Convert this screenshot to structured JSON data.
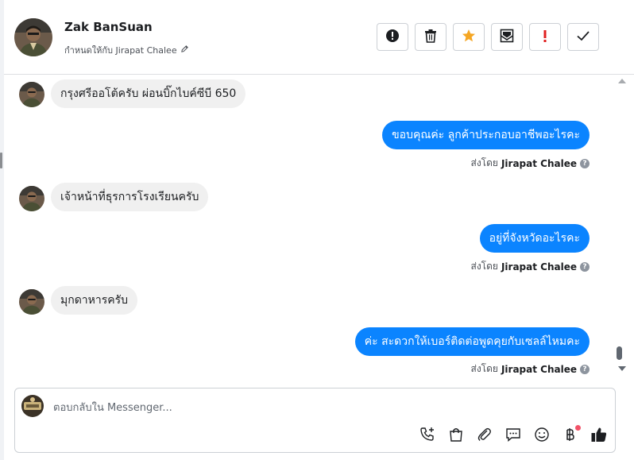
{
  "contact": {
    "name": "Zak BanSuan",
    "assign_label": "กำหนดให้กับ Jirapat Chalee"
  },
  "toolbar": {
    "buttons": [
      {
        "name": "spam-button",
        "icon": "exclamation-circle-icon"
      },
      {
        "name": "delete-button",
        "icon": "trash-icon"
      },
      {
        "name": "star-button",
        "icon": "star-icon",
        "color": "#f5a623"
      },
      {
        "name": "mark-unread-button",
        "icon": "envelope-icon"
      },
      {
        "name": "follow-up-button",
        "icon": "exclamation-icon",
        "color": "#e02020"
      },
      {
        "name": "mark-done-button",
        "icon": "checkmark-icon"
      }
    ]
  },
  "messages": [
    {
      "direction": "in",
      "text": "กรุงศรีออโต้ครับ ผ่อนบิ๊กไบค์ซีบี 650"
    },
    {
      "direction": "out",
      "text": "ขอบคุณค่ะ ลูกค้าประกอบอาชีพอะไรคะ",
      "sent_by_label": "ส่งโดย",
      "sender": "Jirapat Chalee"
    },
    {
      "direction": "in",
      "text": "เจ้าหน้าที่ธุรการโรงเรียนครับ"
    },
    {
      "direction": "out",
      "text": "อยู่ที่จังหวัดอะไรคะ",
      "sent_by_label": "ส่งโดย",
      "sender": "Jirapat Chalee"
    },
    {
      "direction": "in",
      "text": "มุกดาหารครับ"
    },
    {
      "direction": "out",
      "text": "ค่ะ สะดวกให้เบอร์ติดต่อพูดคุยกับเซลล์ไหมคะ",
      "sent_by_label": "ส่งโดย",
      "sender": "Jirapat Chalee"
    }
  ],
  "composer": {
    "placeholder": "ตอบกลับใน Messenger...",
    "tools": [
      "phone-add-icon",
      "shopping-bag-icon",
      "paperclip-icon",
      "saved-reply-icon",
      "emoji-icon",
      "baht-icon",
      "thumbs-up-icon"
    ]
  },
  "colors": {
    "outgoing_bubble": "#0b84ff",
    "incoming_bubble": "#f0f0f0",
    "notification_dot": "#f25268"
  }
}
